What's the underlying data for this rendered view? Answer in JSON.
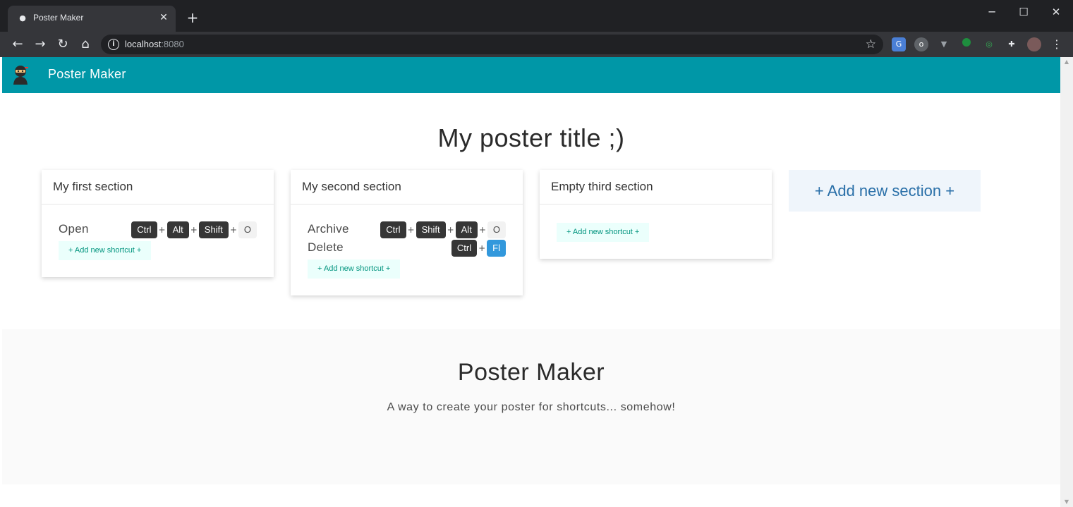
{
  "browser": {
    "tab_title": "Poster Maker",
    "url_host": "localhost",
    "url_port": ":8080"
  },
  "app": {
    "brand": "Poster Maker"
  },
  "poster": {
    "title": "My poster title ;)",
    "sections": [
      {
        "title": "My first section",
        "shortcuts": [
          {
            "label": "Open",
            "keys": [
              {
                "key": "Ctrl",
                "style": "dark"
              },
              {
                "key": "Alt",
                "style": "dark"
              },
              {
                "key": "Shift",
                "style": "dark"
              },
              {
                "key": "O",
                "style": "light"
              }
            ]
          }
        ],
        "add_shortcut_label": "+ Add new shortcut +"
      },
      {
        "title": "My second section",
        "shortcuts": [
          {
            "label": "Archive",
            "keys": [
              {
                "key": "Ctrl",
                "style": "dark"
              },
              {
                "key": "Shift",
                "style": "dark"
              },
              {
                "key": "Alt",
                "style": "dark"
              },
              {
                "key": "O",
                "style": "light"
              }
            ]
          },
          {
            "label": "Delete",
            "keys": [
              {
                "key": "Ctrl",
                "style": "dark"
              },
              {
                "key": "Fl",
                "style": "blue"
              }
            ]
          }
        ],
        "add_shortcut_label": "+ Add new shortcut +"
      },
      {
        "title": "Empty third section",
        "shortcuts": [],
        "add_shortcut_label": "+ Add new shortcut +"
      }
    ],
    "add_section_label": "+ Add new section +"
  },
  "footer": {
    "title": "Poster Maker",
    "subtitle": "A way to create your poster for shortcuts... somehow!"
  },
  "colors": {
    "navbar": "#0097a7",
    "key_dark": "#363636",
    "key_blue": "#3298dc",
    "add_shortcut_bg": "#ebfffc",
    "add_section_bg": "#eff5fb"
  }
}
